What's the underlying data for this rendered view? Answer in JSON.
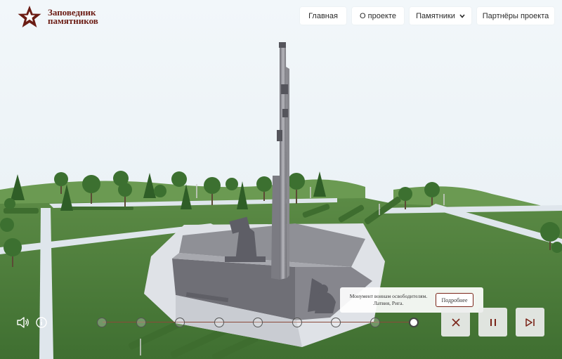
{
  "brand": {
    "line1": "Заповедник",
    "line2": "памятников",
    "color": "#6b1c14"
  },
  "nav": {
    "items": [
      {
        "label": "Главная"
      },
      {
        "label": "О проекте"
      },
      {
        "label": "Памятники",
        "has_dropdown": true
      },
      {
        "label": "Партнёры проекта"
      }
    ]
  },
  "timeline": {
    "total_stops": 9,
    "active_index": 8
  },
  "monument": {
    "line1": "Монумент воинам освободителям.",
    "line2": "Латвия, Рига.",
    "more_label": "Подробнее"
  },
  "controls": {
    "sound_icon": "speaker-icon",
    "info_icon": "info-icon",
    "close_icon": "close-icon",
    "pause_icon": "pause-icon",
    "next_icon": "skip-next-icon"
  },
  "colors": {
    "accent": "#7a2418",
    "sky": "#eef4f8",
    "grass": "#4f7f3e"
  }
}
